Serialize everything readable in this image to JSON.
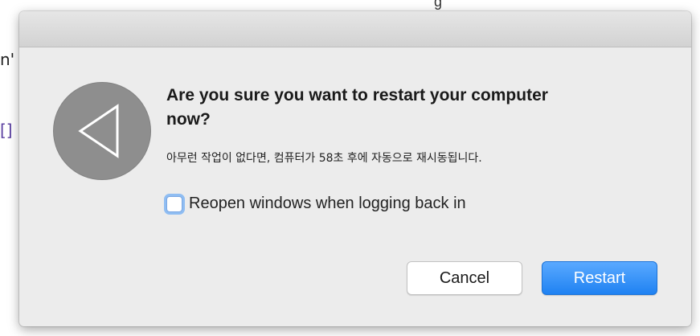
{
  "background": {
    "fragment_top": "n'",
    "fragment_link": "[]",
    "top_line": "g"
  },
  "dialog": {
    "icon": "back-arrow-icon",
    "title": "Are you sure you want to restart your computer now?",
    "message": "아무런 작업이 없다면, 컴퓨터가 58초 후에 자동으로 재시동됩니다.",
    "checkbox_label": "Reopen windows when logging back in",
    "checkbox_checked": false,
    "cancel_label": "Cancel",
    "restart_label": "Restart",
    "accent_color": "#1f82f2"
  }
}
